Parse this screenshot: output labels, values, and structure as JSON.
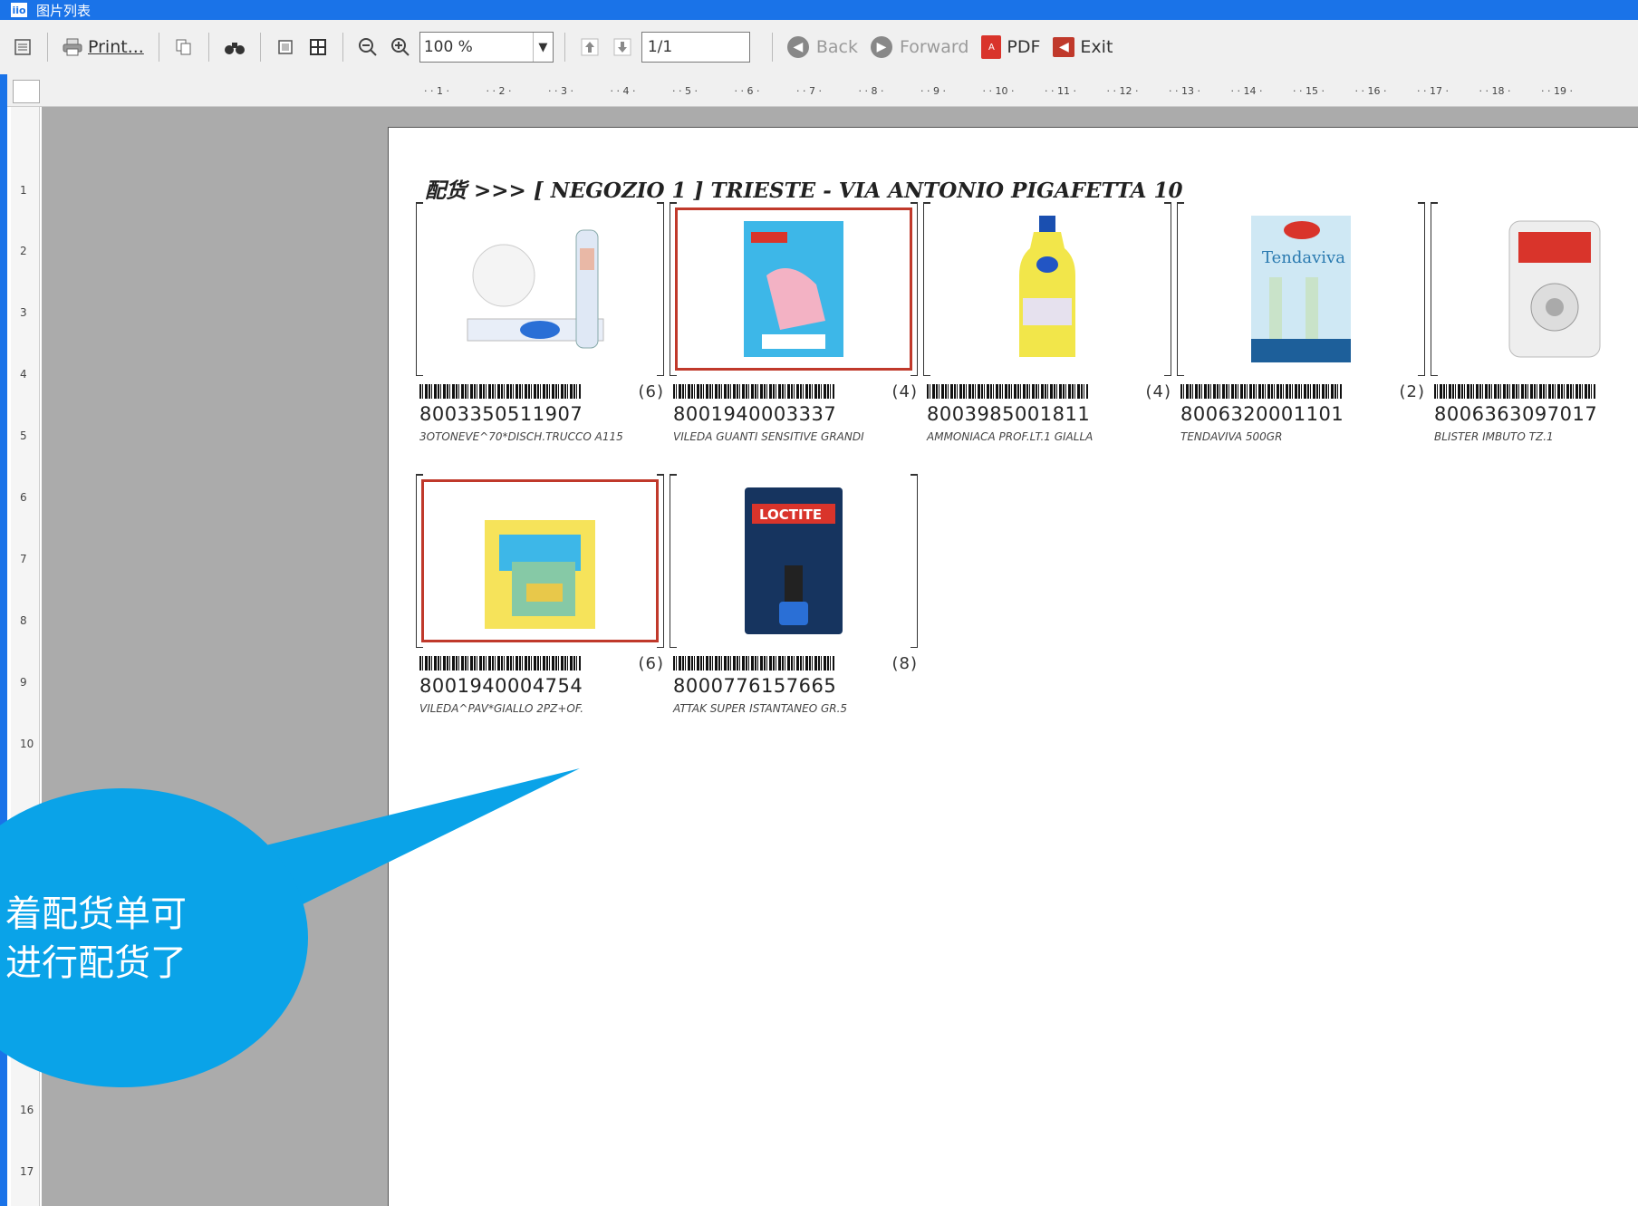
{
  "window": {
    "title": "图片列表",
    "icon_label": "iio"
  },
  "toolbar": {
    "print_label": "Print...",
    "zoom_value": "100 %",
    "page_value": "1/1",
    "back_label": "Back",
    "forward_label": "Forward",
    "pdf_label": "PDF",
    "exit_label": "Exit"
  },
  "ruler": {
    "h_ticks": [
      "1",
      "2",
      "3",
      "4",
      "5",
      "6",
      "7",
      "8",
      "9",
      "10",
      "11",
      "12",
      "13",
      "14",
      "15",
      "16",
      "17",
      "18",
      "19"
    ],
    "v_ticks": [
      "1",
      "2",
      "3",
      "4",
      "5",
      "6",
      "7",
      "8",
      "9",
      "10",
      "16",
      "17"
    ]
  },
  "page": {
    "heading": "配货 >>> [ NEGOZIO 1 ]   TRIESTE - VIA ANTONIO PIGAFETTA 10",
    "products": [
      {
        "qty": "(6)",
        "ean": "8003350511907",
        "desc": "3OTONEVE^70*DISCH.TRUCCO A115",
        "image": "cotton-pads",
        "red_frame": false
      },
      {
        "qty": "(4)",
        "ean": "8001940003337",
        "desc": "VILEDA GUANTI SENSITIVE GRANDI",
        "image": "vileda-gloves",
        "red_frame": true
      },
      {
        "qty": "(4)",
        "ean": "8003985001811",
        "desc": "AMMONIACA PROF.LT.1 GIALLA",
        "image": "ammonia-bottle",
        "red_frame": false
      },
      {
        "qty": "(2)",
        "ean": "8006320001101",
        "desc": "TENDAVIVA 500GR",
        "image": "tendaviva-box",
        "red_frame": false
      },
      {
        "qty": "",
        "ean": "8006363097017",
        "desc": "BLISTER IMBUTO TZ.1",
        "image": "funnel-blister",
        "red_frame": false
      },
      {
        "qty": "(6)",
        "ean": "8001940004754",
        "desc": "VILEDA^PAV*GIALLO 2PZ+OF.",
        "image": "vileda-cloth",
        "red_frame": true
      },
      {
        "qty": "(8)",
        "ean": "8000776157665",
        "desc": "ATTAK SUPER ISTANTANEO GR.5",
        "image": "loctite-glue",
        "red_frame": false
      }
    ]
  },
  "bubble": {
    "line1": "着配货单可",
    "line2": "进行配货了"
  },
  "colors": {
    "title_bar": "#1a73e8",
    "bubble": "#0aa3e8",
    "red_frame": "#c0392b"
  }
}
